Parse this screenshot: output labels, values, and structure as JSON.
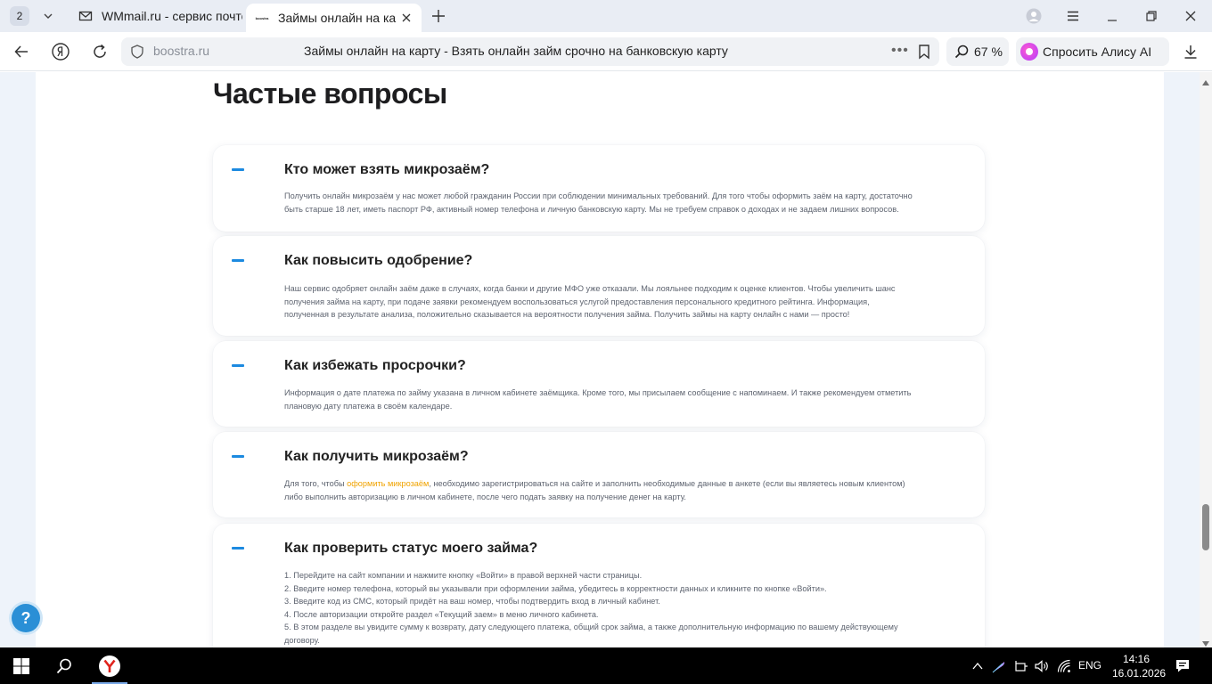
{
  "browser": {
    "tab_count": "2",
    "tabs": [
      {
        "title": "WMmail.ru - сервис почтовых рассылок",
        "favicon": "wmmail-favicon",
        "active": false
      },
      {
        "title": "Займы онлайн на карту",
        "favicon": "boostra-favicon",
        "active": true
      }
    ],
    "favicon_text": "boostra",
    "address": {
      "host": "boostra.ru",
      "page_title": "Займы онлайн на карту - Взять онлайн займ срочно на банковскую карту"
    },
    "zoom": "67 %",
    "alice_label": "Спросить Алису AI"
  },
  "page": {
    "faq_heading": "Частые вопросы",
    "faq": [
      {
        "question": "Кто может взять микрозаём?",
        "answer_lines": [
          "Получить онлайн микрозаём у нас может любой гражданин России при соблюдении минимальных требований. Для того чтобы оформить заём на карту, достаточно",
          "быть старше 18 лет, иметь паспорт РФ, активный номер телефона и личную банковскую карту. Мы не требуем справок о доходах и не задаем лишних вопросов."
        ]
      },
      {
        "question": "Как повысить одобрение?",
        "answer_lines": [
          "Наш сервис одобряет онлайн заём даже в случаях, когда банки и другие МФО уже отказали. Мы лояльнее подходим к оценке клиентов. Чтобы увеличить шанс",
          "получения займа на карту, при подаче заявки рекомендуем воспользоваться услугой предоставления персонального кредитного рейтинга. Информация,",
          "полученная в результате анализа, положительно сказывается на вероятности получения займа. Получить займы на карту онлайн с нами — просто!"
        ]
      },
      {
        "question": "Как избежать просрочки?",
        "answer_lines": [
          "Информация о дате платежа по займу указана в личном кабинете заёмщика. Кроме того, мы присылаем сообщение с напоминаем. И также рекомендуем отметить",
          "плановую дату платежа в своём календаре."
        ]
      },
      {
        "question": "Как получить микрозаём?",
        "answer_prefix": "Для того, чтобы ",
        "answer_link": "оформить микрозаём",
        "answer_suffix": ", необходимо зарегистрироваться на сайте и заполнить необходимые данные в анкете (если вы являетесь новым клиентом)",
        "answer_lines": [
          "либо выполнить авторизацию в личном кабинете, после чего подать заявку на получение денег на карту."
        ]
      },
      {
        "question": "Как проверить статус моего займа?",
        "answer_lines": [
          "1. Перейдите на сайт компании и нажмите кнопку «Войти» в правой верхней части страницы.",
          "2. Введите номер телефона, который вы указывали при оформлении займа, убедитесь в корректности данных и кликните по кнопке «Войти».",
          "3. Введите код из СМС, который придёт на ваш номер, чтобы подтвердить вход в личный кабинет.",
          "4. После авторизации откройте раздел «Текущий заем» в меню личного кабинета.",
          "5. В этом разделе вы увидите сумму к возврату, дату следующего платежа, общий срок займа, а также дополнительную информацию по вашему действующему",
          "договору."
        ]
      }
    ],
    "help_button_label": "?"
  },
  "taskbar": {
    "language": "ENG",
    "time": "14:16",
    "date": "16.01.2026"
  },
  "colors": {
    "accent_blue": "#1c8ae0",
    "link_orange": "#f0a300",
    "page_bg": "#eef3fa"
  }
}
